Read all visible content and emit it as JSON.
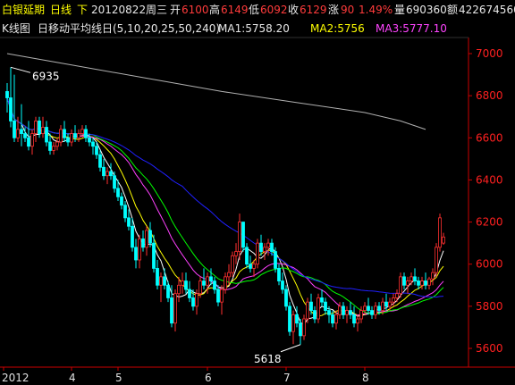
{
  "quote": {
    "name": "白银延期",
    "period": "日线",
    "dir": "下",
    "date": "20120822",
    "weekday": "周三",
    "open_label": "开",
    "open": "6100",
    "high_label": "高",
    "high": "6149",
    "low_label": "低",
    "low": "6092",
    "close_label": "收",
    "close": "6129",
    "chg_label": "涨",
    "chg": "90",
    "pct": "1.49%",
    "vol_label": "量",
    "vol": "690360",
    "amt_label": "额",
    "amt": "422674560"
  },
  "indicator": {
    "kline_label": "K线图",
    "ma_label": "日移动平均线",
    "params": "日(5,10,20,25,50,240)",
    "ma1": "MA1:5758.20",
    "ma2": "MA2:5756",
    "ma3": "MA3:5777.10"
  },
  "annotations": {
    "high": "6935",
    "low": "5618"
  },
  "colors": {
    "up": "#ff3030",
    "down": "#00ffff",
    "ma1": "#ffffff",
    "ma2": "#ffff00",
    "ma3": "#ff40ff",
    "ma4": "#00ff00",
    "ma5": "#2020ff",
    "ma6": "#b0b0b0",
    "axis": "#cc0000",
    "gridLabel": "#ff2020"
  },
  "chart_data": {
    "type": "candlestick",
    "ylim": [
      5450,
      7050
    ],
    "yticks": [
      5600,
      5800,
      6000,
      6200,
      6400,
      6600,
      6800,
      7000
    ],
    "xlabels": [
      "2012",
      "4",
      "5",
      "6",
      "7",
      "8"
    ],
    "candles": [
      [
        6820,
        6860,
        6720,
        6790
      ],
      [
        6790,
        6935,
        6650,
        6680
      ],
      [
        6680,
        6900,
        6580,
        6600
      ],
      [
        6600,
        6700,
        6580,
        6640
      ],
      [
        6640,
        6760,
        6560,
        6620
      ],
      [
        6620,
        6650,
        6580,
        6600
      ],
      [
        6600,
        6680,
        6540,
        6560
      ],
      [
        6560,
        6640,
        6520,
        6620
      ],
      [
        6620,
        6700,
        6580,
        6680
      ],
      [
        6680,
        6700,
        6600,
        6620
      ],
      [
        6620,
        6700,
        6600,
        6650
      ],
      [
        6650,
        6680,
        6560,
        6580
      ],
      [
        6580,
        6620,
        6520,
        6540
      ],
      [
        6540,
        6580,
        6520,
        6560
      ],
      [
        6560,
        6600,
        6540,
        6580
      ],
      [
        6580,
        6660,
        6560,
        6640
      ],
      [
        6640,
        6680,
        6580,
        6600
      ],
      [
        6600,
        6620,
        6560,
        6580
      ],
      [
        6580,
        6640,
        6560,
        6620
      ],
      [
        6620,
        6660,
        6580,
        6600
      ],
      [
        6600,
        6640,
        6580,
        6620
      ],
      [
        6620,
        6660,
        6600,
        6640
      ],
      [
        6640,
        6660,
        6580,
        6600
      ],
      [
        6600,
        6620,
        6560,
        6580
      ],
      [
        6580,
        6600,
        6520,
        6560
      ],
      [
        6560,
        6580,
        6500,
        6520
      ],
      [
        6520,
        6540,
        6440,
        6460
      ],
      [
        6460,
        6500,
        6400,
        6420
      ],
      [
        6420,
        6460,
        6380,
        6440
      ],
      [
        6440,
        6480,
        6400,
        6420
      ],
      [
        6420,
        6440,
        6340,
        6360
      ],
      [
        6360,
        6400,
        6300,
        6320
      ],
      [
        6320,
        6340,
        6260,
        6280
      ],
      [
        6280,
        6300,
        6200,
        6220
      ],
      [
        6220,
        6260,
        6160,
        6180
      ],
      [
        6180,
        6220,
        6060,
        6080
      ],
      [
        6080,
        6120,
        5980,
        6020
      ],
      [
        6020,
        6140,
        5980,
        6120
      ],
      [
        6120,
        6160,
        6060,
        6080
      ],
      [
        6080,
        6180,
        6040,
        6160
      ],
      [
        6160,
        6200,
        6080,
        6100
      ],
      [
        6100,
        6140,
        5960,
        5980
      ],
      [
        5980,
        6020,
        5880,
        5900
      ],
      [
        5900,
        5960,
        5820,
        5940
      ],
      [
        5940,
        5980,
        5880,
        5900
      ],
      [
        5900,
        5920,
        5820,
        5840
      ],
      [
        5840,
        5900,
        5700,
        5720
      ],
      [
        5720,
        5880,
        5680,
        5860
      ],
      [
        5860,
        5940,
        5820,
        5900
      ],
      [
        5900,
        5960,
        5860,
        5920
      ],
      [
        5920,
        5960,
        5860,
        5880
      ],
      [
        5880,
        5920,
        5820,
        5840
      ],
      [
        5840,
        5880,
        5780,
        5800
      ],
      [
        5800,
        5880,
        5760,
        5860
      ],
      [
        5860,
        5940,
        5840,
        5920
      ],
      [
        5920,
        5980,
        5880,
        5900
      ],
      [
        5900,
        5960,
        5860,
        5940
      ],
      [
        5940,
        5980,
        5900,
        5920
      ],
      [
        5920,
        5940,
        5860,
        5880
      ],
      [
        5880,
        5900,
        5800,
        5820
      ],
      [
        5820,
        5900,
        5760,
        5880
      ],
      [
        5880,
        5960,
        5860,
        5940
      ],
      [
        5940,
        6000,
        5900,
        5960
      ],
      [
        5960,
        6060,
        5940,
        6040
      ],
      [
        6040,
        6100,
        6000,
        6060
      ],
      [
        6060,
        6240,
        6020,
        6200
      ],
      [
        6200,
        6200,
        6060,
        6080
      ],
      [
        6080,
        6100,
        5980,
        6000
      ],
      [
        6000,
        6040,
        5960,
        5980
      ],
      [
        5980,
        6020,
        5940,
        6000
      ],
      [
        6000,
        6120,
        5980,
        6100
      ],
      [
        6100,
        6140,
        6040,
        6060
      ],
      [
        6060,
        6100,
        6020,
        6080
      ],
      [
        6080,
        6120,
        6040,
        6100
      ],
      [
        6100,
        6120,
        6040,
        6060
      ],
      [
        6060,
        6080,
        5960,
        5980
      ],
      [
        5980,
        6000,
        5900,
        5920
      ],
      [
        5920,
        5960,
        5860,
        5880
      ],
      [
        5880,
        5900,
        5780,
        5800
      ],
      [
        5800,
        5820,
        5660,
        5680
      ],
      [
        5680,
        5780,
        5620,
        5760
      ],
      [
        5760,
        5800,
        5700,
        5720
      ],
      [
        5720,
        5740,
        5618,
        5660
      ],
      [
        5660,
        5760,
        5640,
        5740
      ],
      [
        5740,
        5840,
        5720,
        5820
      ],
      [
        5820,
        5860,
        5760,
        5780
      ],
      [
        5780,
        5800,
        5720,
        5740
      ],
      [
        5740,
        5860,
        5720,
        5840
      ],
      [
        5840,
        5880,
        5800,
        5820
      ],
      [
        5820,
        5840,
        5760,
        5780
      ],
      [
        5780,
        5800,
        5720,
        5760
      ],
      [
        5760,
        5780,
        5700,
        5720
      ],
      [
        5720,
        5780,
        5690,
        5760
      ],
      [
        5760,
        5820,
        5740,
        5800
      ],
      [
        5800,
        5820,
        5740,
        5760
      ],
      [
        5760,
        5800,
        5720,
        5780
      ],
      [
        5780,
        5820,
        5740,
        5760
      ],
      [
        5760,
        5800,
        5700,
        5720
      ],
      [
        5720,
        5760,
        5680,
        5740
      ],
      [
        5740,
        5800,
        5720,
        5780
      ],
      [
        5780,
        5820,
        5760,
        5800
      ],
      [
        5800,
        5840,
        5760,
        5780
      ],
      [
        5780,
        5800,
        5740,
        5760
      ],
      [
        5760,
        5820,
        5740,
        5800
      ],
      [
        5800,
        5820,
        5760,
        5780
      ],
      [
        5780,
        5840,
        5760,
        5820
      ],
      [
        5820,
        5860,
        5780,
        5800
      ],
      [
        5800,
        5840,
        5780,
        5820
      ],
      [
        5820,
        5860,
        5800,
        5840
      ],
      [
        5840,
        5880,
        5820,
        5860
      ],
      [
        5860,
        5960,
        5840,
        5940
      ],
      [
        5940,
        5960,
        5880,
        5900
      ],
      [
        5900,
        5940,
        5860,
        5920
      ],
      [
        5920,
        5960,
        5900,
        5940
      ],
      [
        5940,
        5980,
        5900,
        5920
      ],
      [
        5920,
        5940,
        5880,
        5900
      ],
      [
        5900,
        5940,
        5880,
        5920
      ],
      [
        5920,
        5960,
        5880,
        5900
      ],
      [
        5900,
        5940,
        5880,
        5930
      ],
      [
        5930,
        5980,
        5900,
        5960
      ],
      [
        5960,
        6100,
        5940,
        6080
      ],
      [
        6080,
        6240,
        6060,
        6220
      ],
      [
        6100,
        6149,
        6092,
        6129
      ]
    ],
    "ma6": [
      [
        0,
        7000
      ],
      [
        20,
        6940
      ],
      [
        40,
        6880
      ],
      [
        60,
        6820
      ],
      [
        80,
        6770
      ],
      [
        100,
        6720
      ],
      [
        110,
        6680
      ],
      [
        117,
        6640
      ]
    ],
    "high_index": 1,
    "low_index": 82
  }
}
